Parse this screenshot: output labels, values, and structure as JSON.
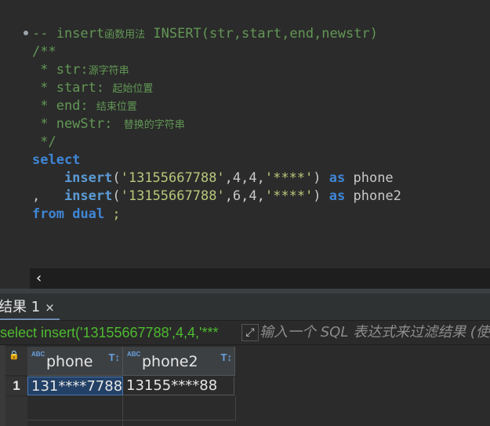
{
  "editor": {
    "lines": [
      {
        "parts": [
          {
            "t": "-- insert",
            "c": "cm"
          },
          {
            "t": "函数用法",
            "c": "cm-small"
          },
          {
            "t": " INSERT(str,start,end,newstr)",
            "c": "cm"
          }
        ]
      },
      {
        "parts": [
          {
            "t": "/**",
            "c": "cm"
          }
        ]
      },
      {
        "parts": [
          {
            "t": " * str:",
            "c": "cm"
          },
          {
            "t": "源字符串",
            "c": "cm-small"
          }
        ]
      },
      {
        "parts": [
          {
            "t": " * start: ",
            "c": "cm"
          },
          {
            "t": "起始位置",
            "c": "cm-small"
          }
        ]
      },
      {
        "parts": [
          {
            "t": " * end: ",
            "c": "cm"
          },
          {
            "t": "结束位置",
            "c": "cm-small"
          }
        ]
      },
      {
        "parts": [
          {
            "t": " * newStr: ",
            "c": "cm"
          },
          {
            "t": " 替换的字符串",
            "c": "cm-small"
          }
        ]
      },
      {
        "parts": [
          {
            "t": " */",
            "c": "cm"
          }
        ]
      },
      {
        "parts": [
          {
            "t": "select",
            "c": "kw"
          }
        ]
      },
      {
        "parts": [
          {
            "t": "    insert",
            "c": "fn"
          },
          {
            "t": "(",
            "c": "txt"
          },
          {
            "t": "'13155667788'",
            "c": "str"
          },
          {
            "t": ",4,4,",
            "c": "num"
          },
          {
            "t": "'****'",
            "c": "str"
          },
          {
            "t": ") ",
            "c": "txt"
          },
          {
            "t": "as",
            "c": "kw"
          },
          {
            "t": " phone",
            "c": "txt"
          }
        ]
      },
      {
        "parts": [
          {
            "t": ",   ",
            "c": "txt"
          },
          {
            "t": "insert",
            "c": "fn"
          },
          {
            "t": "(",
            "c": "txt"
          },
          {
            "t": "'13155667788'",
            "c": "str"
          },
          {
            "t": ",6,4,",
            "c": "num"
          },
          {
            "t": "'****'",
            "c": "str"
          },
          {
            "t": ") ",
            "c": "txt"
          },
          {
            "t": "as",
            "c": "kw"
          },
          {
            "t": " phone2",
            "c": "txt"
          }
        ]
      },
      {
        "parts": [
          {
            "t": "from",
            "c": "kw"
          },
          {
            "t": " ",
            "c": "txt"
          },
          {
            "t": "dual",
            "c": "kw"
          },
          {
            "t": " ;",
            "c": "str"
          }
        ]
      }
    ]
  },
  "scroll_left_icon": "chevron-left-icon",
  "result_tab": {
    "label": "结果 1",
    "close": "×"
  },
  "filter": {
    "query": "select insert('13155667788',4,4,'***",
    "expand_icon": "⤢",
    "placeholder": "输入一个 SQL 表达式来过滤结果 (使用"
  },
  "grid": {
    "columns": [
      {
        "type": "ABC",
        "name": "phone",
        "sort": "T↕"
      },
      {
        "type": "ABC",
        "name": "phone2",
        "sort": "T↕"
      }
    ],
    "rows": [
      {
        "num": "1",
        "cells": [
          "131****7788",
          "13155****88"
        ]
      }
    ]
  },
  "colors": {
    "comment": "#629755",
    "keyword": "#3f86d6",
    "string": "#b8c87a",
    "query": "#4dbb2f",
    "selection": "#234066"
  }
}
